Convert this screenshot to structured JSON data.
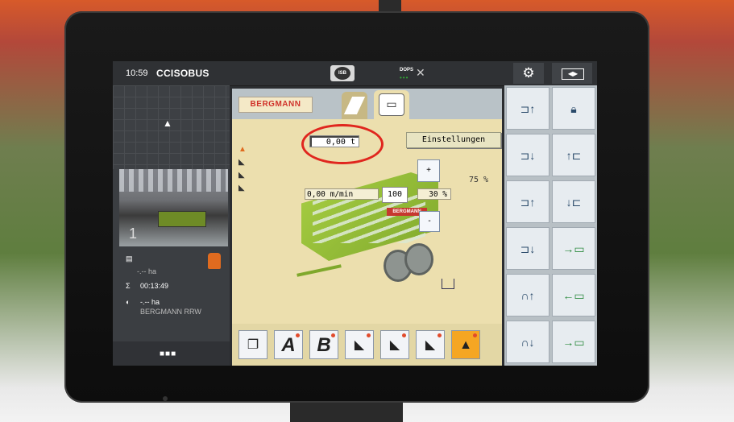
{
  "topbar": {
    "time": "10:59",
    "logo": "CCISOBUS",
    "isb_label": "ISB",
    "dops_label": "DOPS",
    "gear_icon": "gear-icon",
    "switch_icon": "screen-switch-icon"
  },
  "left_panel": {
    "camera_number": "1",
    "info": {
      "area_value": "-.-- ha",
      "time_value": "00:13:49",
      "area2_value": "-.-- ha",
      "machine_name": "BERGMANN RRW"
    }
  },
  "main": {
    "brand_tab": "BERGMANN",
    "weight": "0,00 t",
    "settings_button": "Einstellungen",
    "speed": "0,00 m/min",
    "value_100": "100",
    "percent_30": "30 %",
    "percent_75": "75 %",
    "plus": "+",
    "minus": "-",
    "wagon_sign": "BERGMANN"
  },
  "bottom_buttons": [
    {
      "label": "",
      "icon": "pages-icon"
    },
    {
      "label": "A",
      "icon": "a-icon"
    },
    {
      "label": "B",
      "icon": "b-icon"
    },
    {
      "label": "",
      "icon": "pickup-1-icon"
    },
    {
      "label": "",
      "icon": "pickup-2-icon"
    },
    {
      "label": "",
      "icon": "pickup-3-icon"
    },
    {
      "label": "",
      "icon": "beacon-icon"
    }
  ],
  "right_buttons": [
    "wagon-up-icon",
    "lock-icon",
    "wagon-down-icon",
    "tailgate-up-icon",
    "wagon-rear-up-icon",
    "tailgate-down-icon",
    "wagon-rear-down-icon",
    "conveyor-forward-icon",
    "axle-up-icon",
    "conveyor-reverse-icon",
    "axle-down-icon",
    "conveyor-forward-2-icon"
  ],
  "colors": {
    "highlight_ring": "#e0261e",
    "active_button": "#f5a623",
    "main_bg": "#ecdfae"
  }
}
